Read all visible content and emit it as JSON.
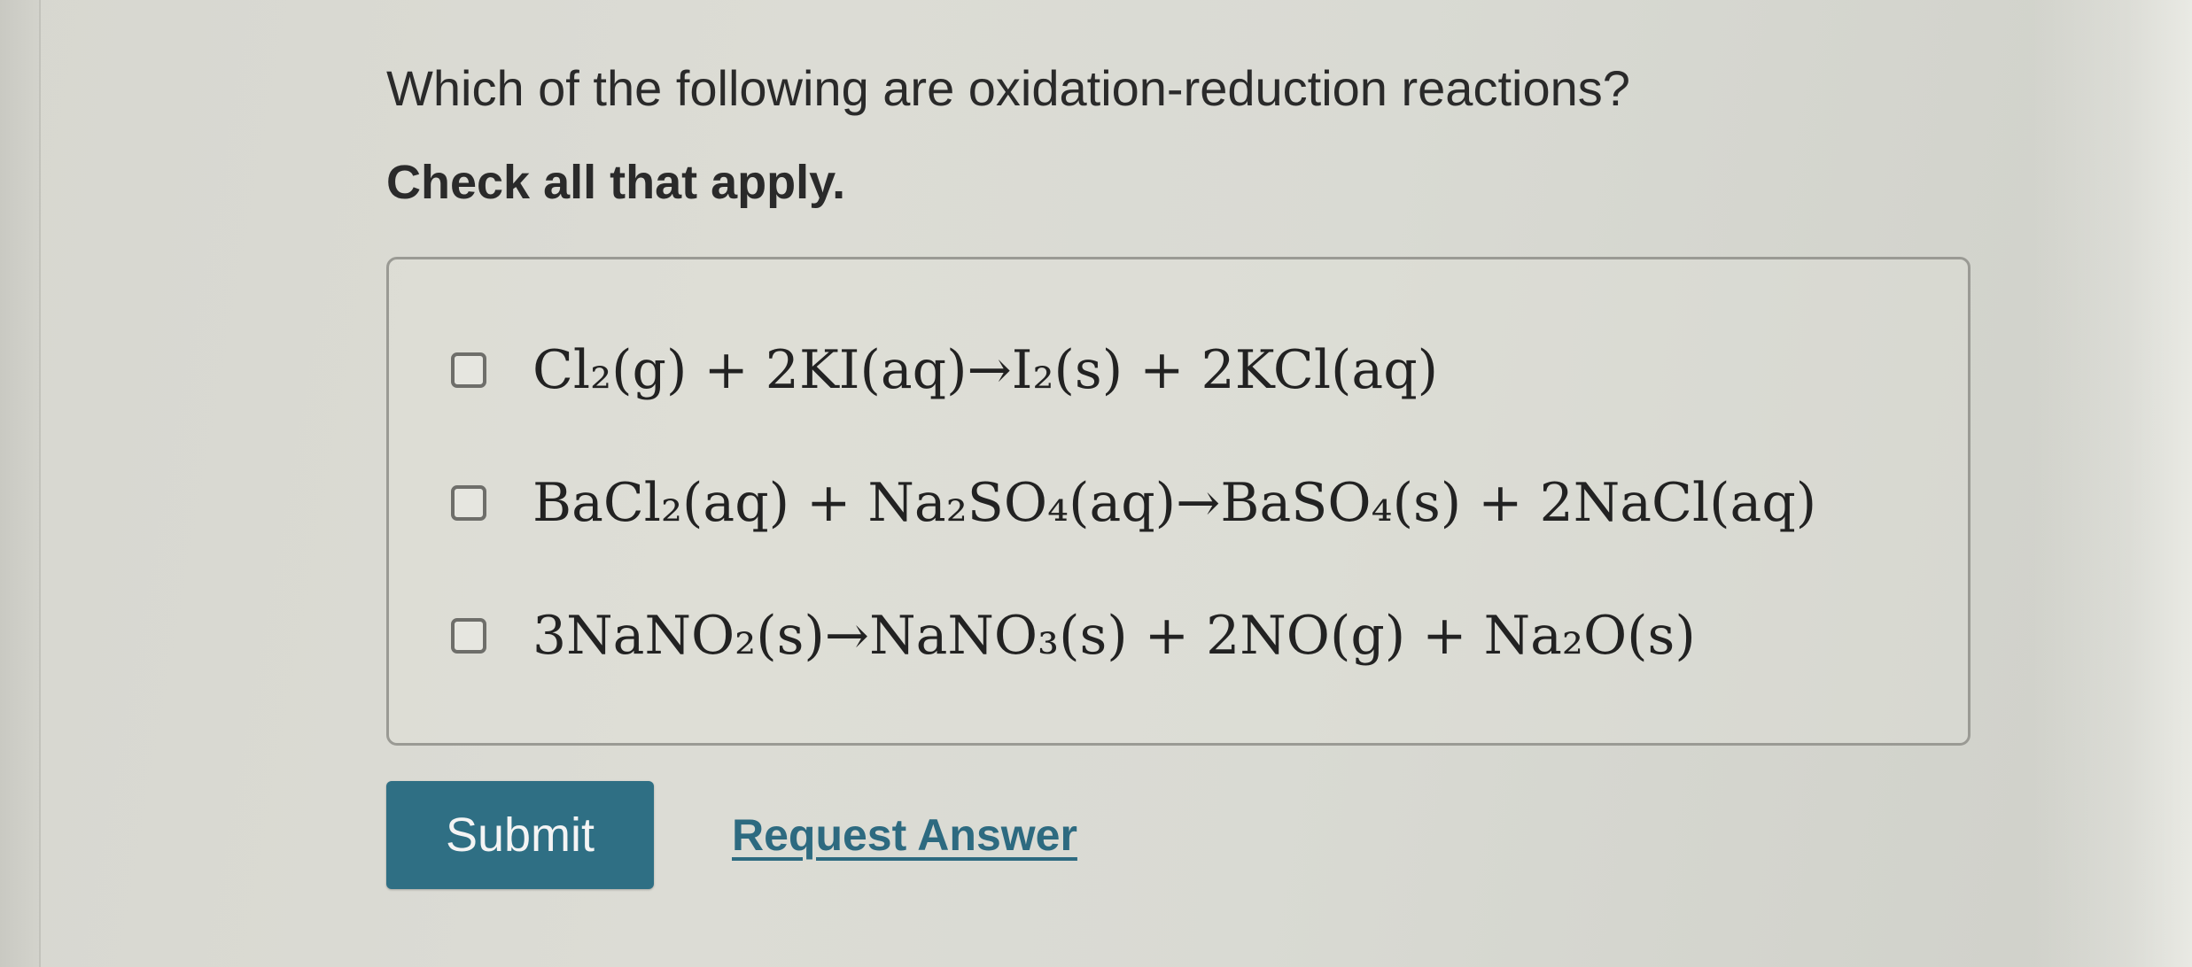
{
  "question": {
    "text": "Which of the following are oxidation-reduction reactions?",
    "instruction": "Check all that apply."
  },
  "options": [
    {
      "equation": "Cl₂(g) + 2KI(aq)→I₂(s) + 2KCl(aq)",
      "checked": false
    },
    {
      "equation": "BaCl₂(aq) + Na₂SO₄(aq)→BaSO₄(s) + 2NaCl(aq)",
      "checked": false
    },
    {
      "equation": "3NaNO₂(s)→NaNO₃(s) + 2NO(g) + Na₂O(s)",
      "checked": false
    }
  ],
  "actions": {
    "submit_label": "Submit",
    "request_answer_label": "Request Answer"
  },
  "colors": {
    "accent": "#2f6f84",
    "link": "#2d6a80",
    "background": "#d9d9d2"
  }
}
